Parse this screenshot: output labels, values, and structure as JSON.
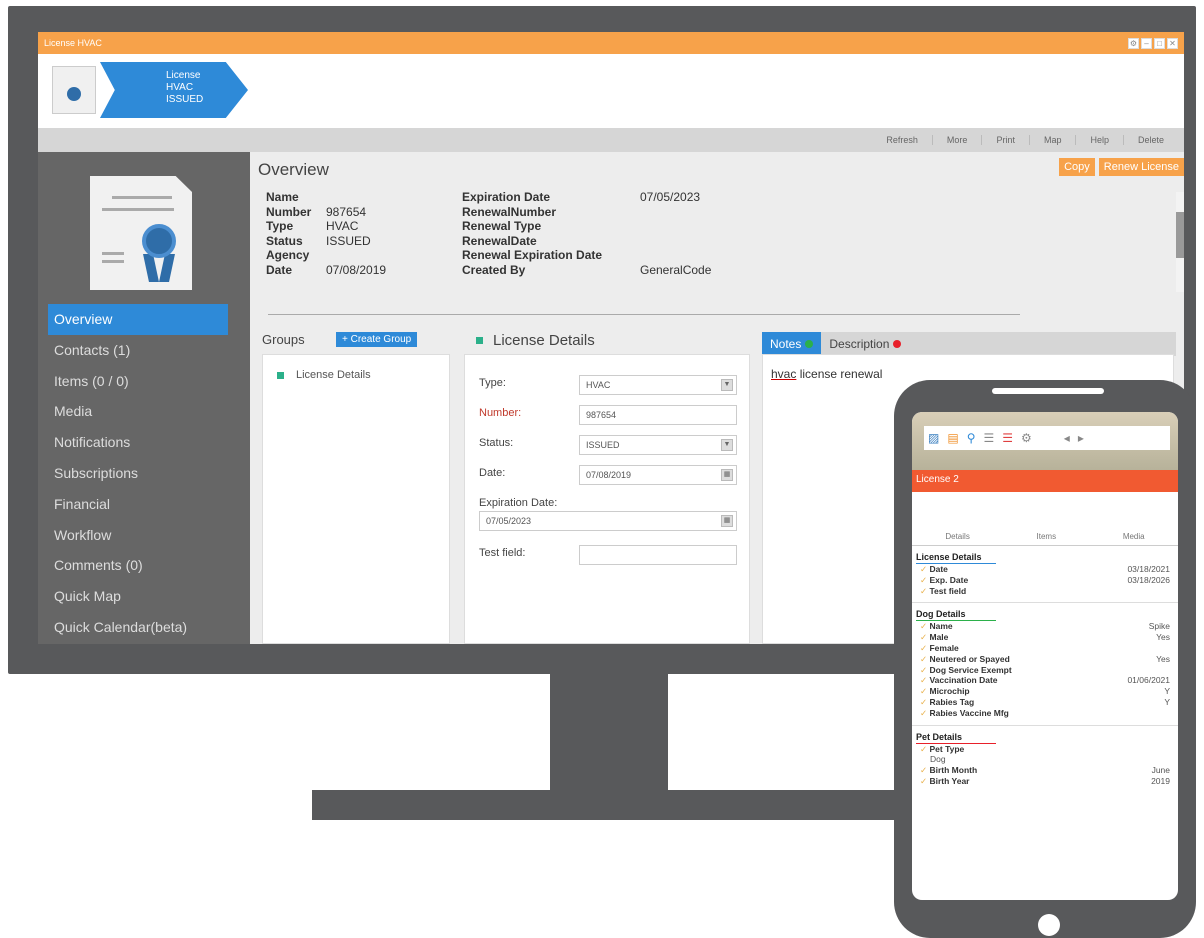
{
  "window": {
    "title": "License HVAC",
    "controls": [
      "⚙",
      "–",
      "□",
      "✕"
    ]
  },
  "breadcrumb": [
    "License",
    "HVAC",
    "ISSUED"
  ],
  "toolbar": [
    "Refresh",
    "More",
    "Print",
    "Map",
    "Help",
    "Delete"
  ],
  "sidebar": {
    "items": [
      {
        "label": "Overview",
        "active": true
      },
      {
        "label": "Contacts (1)"
      },
      {
        "label": "Items (0 / 0)"
      },
      {
        "label": "Media"
      },
      {
        "label": "Notifications"
      },
      {
        "label": "Subscriptions"
      },
      {
        "label": "Financial"
      },
      {
        "label": "Workflow"
      },
      {
        "label": "Comments (0)"
      },
      {
        "label": "Quick Map"
      },
      {
        "label": "Quick Calendar(beta)"
      }
    ]
  },
  "overview": {
    "title": "Overview",
    "buttons": {
      "copy": "Copy",
      "renew": "Renew License"
    },
    "left": [
      {
        "label": "Name",
        "value": ""
      },
      {
        "label": "Number",
        "value": "987654"
      },
      {
        "label": "Type",
        "value": "HVAC"
      },
      {
        "label": "Status",
        "value": "ISSUED"
      },
      {
        "label": "Agency",
        "value": ""
      },
      {
        "label": "Date",
        "value": "07/08/2019"
      }
    ],
    "right": [
      {
        "label": "Expiration Date",
        "value": "07/05/2023"
      },
      {
        "label": "RenewalNumber",
        "value": ""
      },
      {
        "label": "Renewal Type",
        "value": ""
      },
      {
        "label": "RenewalDate",
        "value": ""
      },
      {
        "label": "Renewal Expiration Date",
        "value": ""
      },
      {
        "label": "Created By",
        "value": "GeneralCode"
      }
    ]
  },
  "groups": {
    "header": "Groups",
    "create": "Create Group",
    "items": [
      "License Details"
    ]
  },
  "license_details": {
    "header": "License Details",
    "fields": {
      "type_label": "Type:",
      "type_value": "HVAC",
      "number_label": "Number:",
      "number_value": "987654",
      "status_label": "Status:",
      "status_value": "ISSUED",
      "date_label": "Date:",
      "date_value": "07/08/2019",
      "exp_label": "Expiration Date:",
      "exp_value": "07/05/2023",
      "test_label": "Test field:",
      "test_value": ""
    }
  },
  "notes": {
    "tab_notes": "Notes",
    "tab_description": "Description",
    "text_prefix": "hvac",
    "text_rest": " license renewal"
  },
  "colors": {
    "accent_orange": "#f7a24a",
    "accent_blue": "#2e8ad8",
    "sidebar_bg": "#666666",
    "phone_bar": "#f15a31"
  },
  "phone": {
    "title_bar": "License 2",
    "tabs": [
      "Details",
      "Items",
      "Media"
    ],
    "license_details": {
      "header": "License Details",
      "rows": [
        {
          "k": "Date",
          "v": "03/18/2021"
        },
        {
          "k": "Exp. Date",
          "v": "03/18/2026"
        },
        {
          "k": "Test field",
          "v": ""
        }
      ]
    },
    "dog_details": {
      "header": "Dog Details",
      "rows": [
        {
          "k": "Name",
          "v": "Spike"
        },
        {
          "k": "Male",
          "v": "Yes"
        },
        {
          "k": "Female",
          "v": ""
        },
        {
          "k": "Neutered or Spayed",
          "v": "Yes"
        },
        {
          "k": "Dog Service Exempt",
          "v": ""
        },
        {
          "k": "Vaccination Date",
          "v": "01/06/2021"
        },
        {
          "k": "Microchip",
          "v": "Y"
        },
        {
          "k": "Rabies Tag",
          "v": "Y"
        },
        {
          "k": "Rabies Vaccine Mfg",
          "v": ""
        }
      ]
    },
    "pet_details": {
      "header": "Pet Details",
      "pet_type_label": "Pet Type",
      "pet_type_value": "Dog",
      "rows": [
        {
          "k": "Birth Month",
          "v": "June"
        },
        {
          "k": "Birth Year",
          "v": "2019"
        }
      ]
    }
  }
}
